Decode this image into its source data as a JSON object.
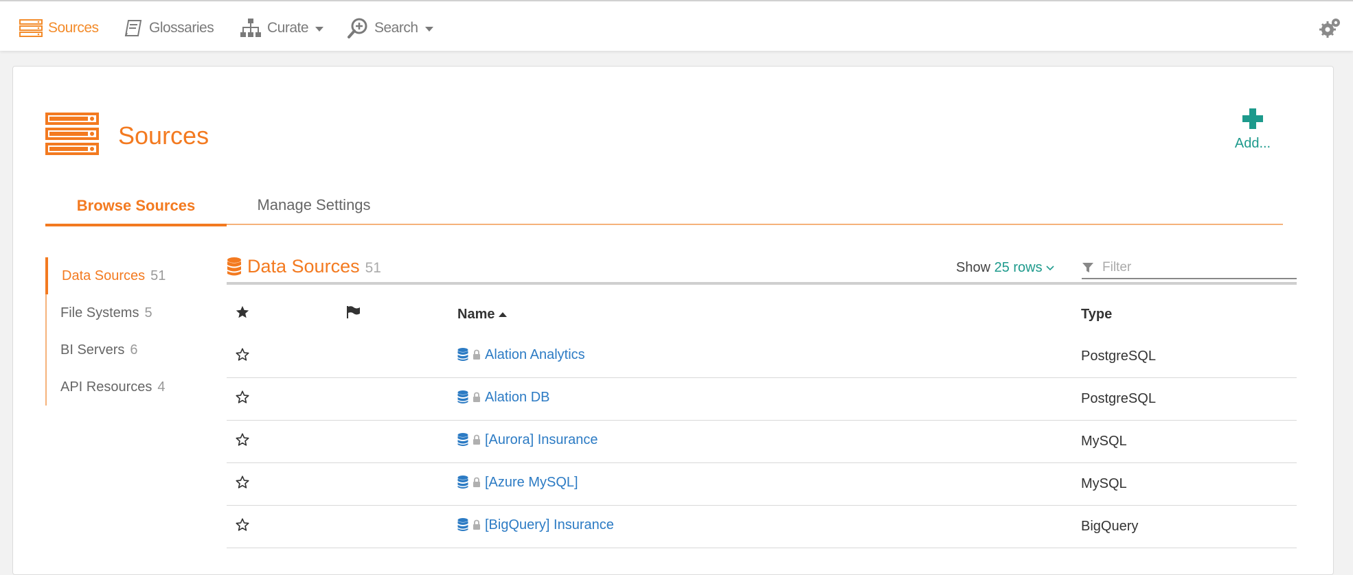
{
  "nav": {
    "items": [
      {
        "label": "Sources",
        "icon": "server-icon",
        "active": true
      },
      {
        "label": "Glossaries",
        "icon": "book-icon",
        "active": false
      },
      {
        "label": "Curate",
        "icon": "hierarchy-icon",
        "active": false,
        "dropdown": true
      },
      {
        "label": "Search",
        "icon": "search-plus-icon",
        "active": false,
        "dropdown": true
      }
    ],
    "settings_icon": "gears-icon"
  },
  "page": {
    "title": "Sources",
    "add_label": "Add..."
  },
  "tabs": [
    {
      "label": "Browse Sources",
      "active": true
    },
    {
      "label": "Manage Settings",
      "active": false
    }
  ],
  "sidebar": {
    "items": [
      {
        "label": "Data Sources",
        "count": "51",
        "active": true
      },
      {
        "label": "File Systems",
        "count": "5",
        "active": false
      },
      {
        "label": "BI Servers",
        "count": "6",
        "active": false
      },
      {
        "label": "API Resources",
        "count": "4",
        "active": false
      }
    ]
  },
  "panel": {
    "title": "Data Sources",
    "count": "51",
    "show_label": "Show",
    "rows_label": "25 rows",
    "filter_placeholder": "Filter"
  },
  "table": {
    "headers": {
      "name": "Name",
      "type": "Type"
    },
    "rows": [
      {
        "name": "Alation Analytics",
        "type": "PostgreSQL"
      },
      {
        "name": "Alation DB",
        "type": "PostgreSQL"
      },
      {
        "name": "[Aurora] Insurance",
        "type": "MySQL"
      },
      {
        "name": "[Azure MySQL]",
        "type": "MySQL"
      },
      {
        "name": "[BigQuery] Insurance",
        "type": "BigQuery"
      }
    ]
  },
  "colors": {
    "accent": "#f37a20",
    "teal": "#1d9a8c",
    "link": "#2c7bc4"
  }
}
